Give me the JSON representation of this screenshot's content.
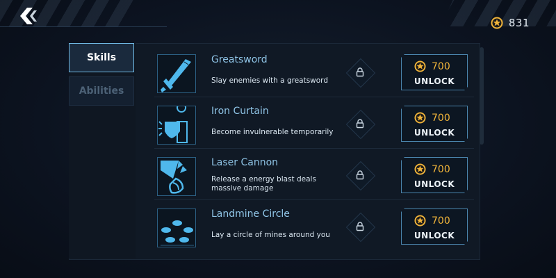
{
  "currency": {
    "icon": "star-coin-icon",
    "amount": "831"
  },
  "tabs": [
    {
      "label": "Skills",
      "active": true
    },
    {
      "label": "Abilities",
      "active": false
    }
  ],
  "skills": [
    {
      "title": "Greatsword",
      "description": "Slay enemies with a greatsword",
      "icon": "greatsword-icon",
      "price": "700",
      "button": "UNLOCK"
    },
    {
      "title": "Iron Curtain",
      "description": "Become invulnerable temporarily",
      "icon": "iron-curtain-icon",
      "price": "700",
      "button": "UNLOCK"
    },
    {
      "title": "Laser Cannon",
      "description": "Release a energy blast deals massive damage",
      "icon": "laser-cannon-icon",
      "price": "700",
      "button": "UNLOCK"
    },
    {
      "title": "Landmine Circle",
      "description": "Lay a circle of mines around you",
      "icon": "landmine-circle-icon",
      "price": "700",
      "button": "UNLOCK"
    }
  ],
  "colors": {
    "accent": "#4fb8ec",
    "coin": "#f2b53a",
    "panel": "#101925"
  }
}
